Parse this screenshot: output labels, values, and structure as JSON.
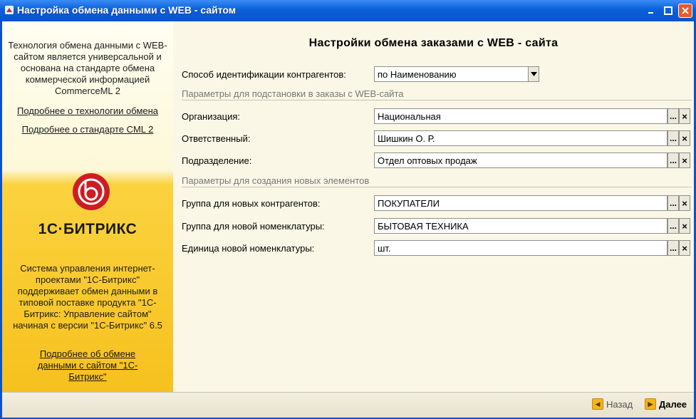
{
  "window": {
    "title": "Настройка обмена данными с WEB - сайтом"
  },
  "sidebar": {
    "intro": "Технология обмена данными с WEB-сайтом является универсальной и основана на стандарте обмена коммерческой информацией CommerceML 2",
    "link_technology": "Подробнее о технологии обмена",
    "link_standard": "Подробнее о стандарте CML 2",
    "brand": "1С·БИТРИКС",
    "description": "Система управления интернет-проектами \"1С-Битрикс\" поддерживает обмен данными в типовой поставке продукта \"1С-Битрикс: Управление сайтом\" начиная с версии \"1С-Битрикс\" 6.5",
    "link_bitrix": "Подробнее об обмене данными с сайтом \"1С-Битрикс\""
  },
  "main": {
    "title": "Настройки обмена заказами с WEB - сайта",
    "identification": {
      "label": "Способ идентификации контрагентов:",
      "value": "по Наименованию"
    },
    "section_orders": "Параметры для подстановки в заказы с WEB-сайта",
    "organization": {
      "label": "Организация:",
      "value": "Национальная"
    },
    "responsible": {
      "label": "Ответственный:",
      "value": "Шишкин О. Р."
    },
    "department": {
      "label": "Подразделение:",
      "value": "Отдел оптовых продаж"
    },
    "section_new": "Параметры для создания новых элементов",
    "group_contractors": {
      "label": "Группа для новых контрагентов:",
      "value": "ПОКУПАТЕЛИ"
    },
    "group_nomenclature": {
      "label": "Группа для новой номенклатуры:",
      "value": "БЫТОВАЯ ТЕХНИКА"
    },
    "unit": {
      "label": "Единица новой номенклатуры:",
      "value": "шт."
    }
  },
  "footer": {
    "back_label": "Назад",
    "next_label": "Далее"
  }
}
